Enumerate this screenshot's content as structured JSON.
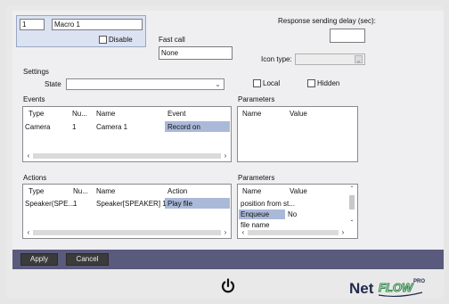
{
  "macro": {
    "id": "1",
    "name": "Macro 1",
    "disable_label": "Disable"
  },
  "fast_call": {
    "label": "Fast call",
    "value": "None"
  },
  "response_delay": {
    "label": "Response sending delay (sec):",
    "value": ""
  },
  "icon_type": {
    "label": "Icon type:"
  },
  "settings": {
    "label": "Settings",
    "state_label": "State",
    "state_value": "",
    "local_label": "Local",
    "hidden_label": "Hidden"
  },
  "events": {
    "title": "Events",
    "columns": [
      "Type",
      "Nu...",
      "Name",
      "Event"
    ],
    "rows": [
      [
        "Camera",
        "1",
        "Camera 1",
        "Record on"
      ]
    ]
  },
  "events_params": {
    "title": "Parameters",
    "columns": [
      "Name",
      "Value"
    ]
  },
  "actions": {
    "title": "Actions",
    "columns": [
      "Type",
      "Nu...",
      "Name",
      "Action"
    ],
    "rows": [
      [
        "Speaker(SPE...",
        "1",
        "Speaker[SPEAKER] 1",
        "Play file"
      ]
    ]
  },
  "actions_params": {
    "title": "Parameters",
    "columns": [
      "Name",
      "Value"
    ],
    "rows": [
      [
        "position from st...",
        ""
      ],
      [
        "Enqueue",
        "No"
      ],
      [
        "file name",
        ""
      ]
    ]
  },
  "buttons": {
    "apply": "Apply",
    "cancel": "Cancel"
  },
  "brand": {
    "name": "Net",
    "sub": "FLOW",
    "pro": "PRO"
  },
  "colors": {
    "selection": "#aab9d8",
    "footer": "#5a5a7c",
    "logo_dark": "#1f2a4e",
    "logo_green": "#2f8a4a"
  }
}
